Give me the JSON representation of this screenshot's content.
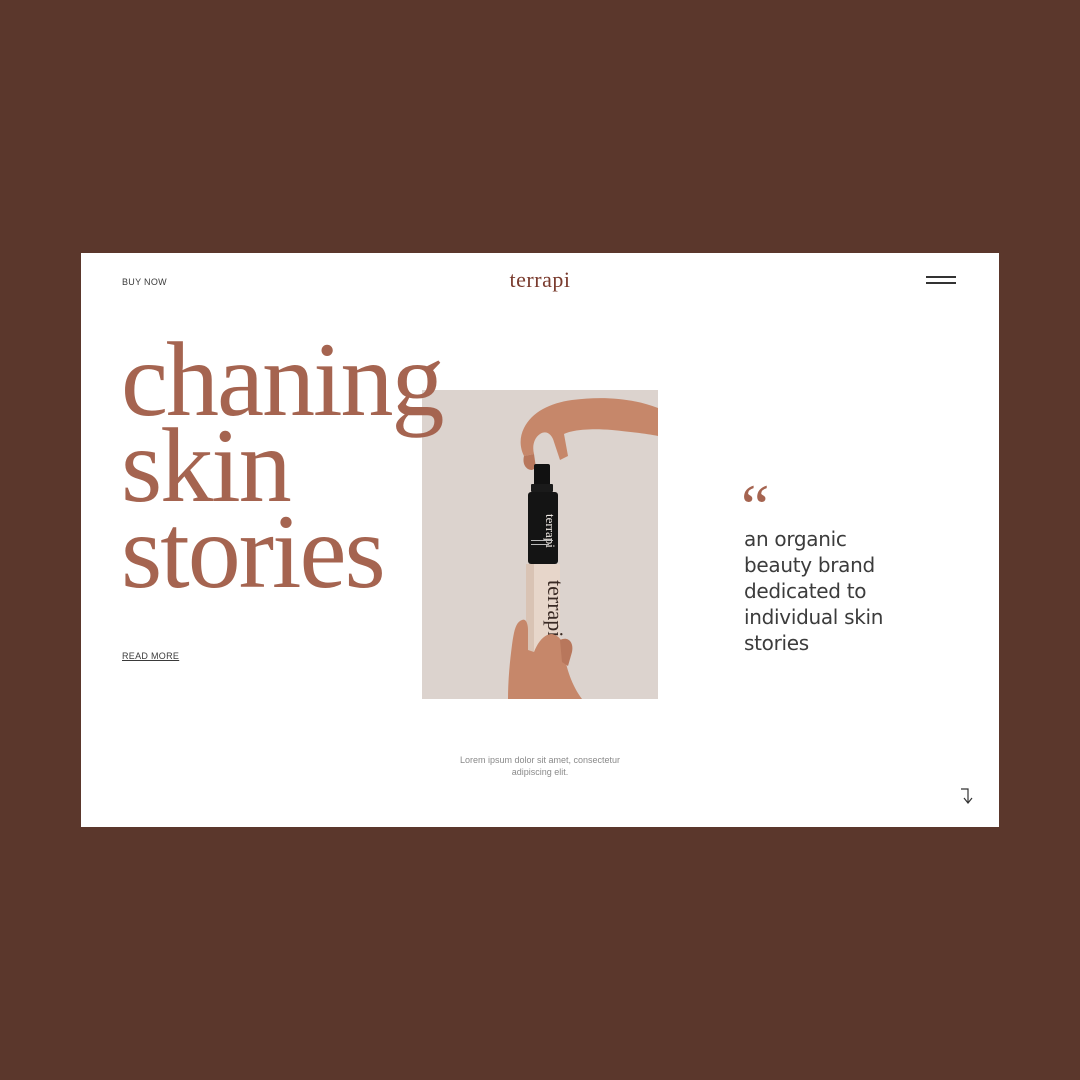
{
  "header": {
    "buy_now": "BUY NOW",
    "logo": "terrapi",
    "menu_icon": "hamburger-icon"
  },
  "hero": {
    "line1": "chaning",
    "line2": "skin",
    "line3": "stories",
    "read_more": "READ MORE"
  },
  "quote": {
    "mark": "“",
    "text": "an organic beauty brand dedicated to individual skin stories"
  },
  "caption": {
    "line1": "Lorem ipsum dolor sit amet, consectetur",
    "line2": "adipiscing elit."
  },
  "product": {
    "bottle_brand": "terrapi",
    "box_brand": "terrapi"
  },
  "icons": {
    "scroll": "arrow-down-right-icon"
  },
  "colors": {
    "background": "#5b372c",
    "accent": "#a56450",
    "logo": "#7a3b2e",
    "photo_bg": "#dcd3ce"
  }
}
